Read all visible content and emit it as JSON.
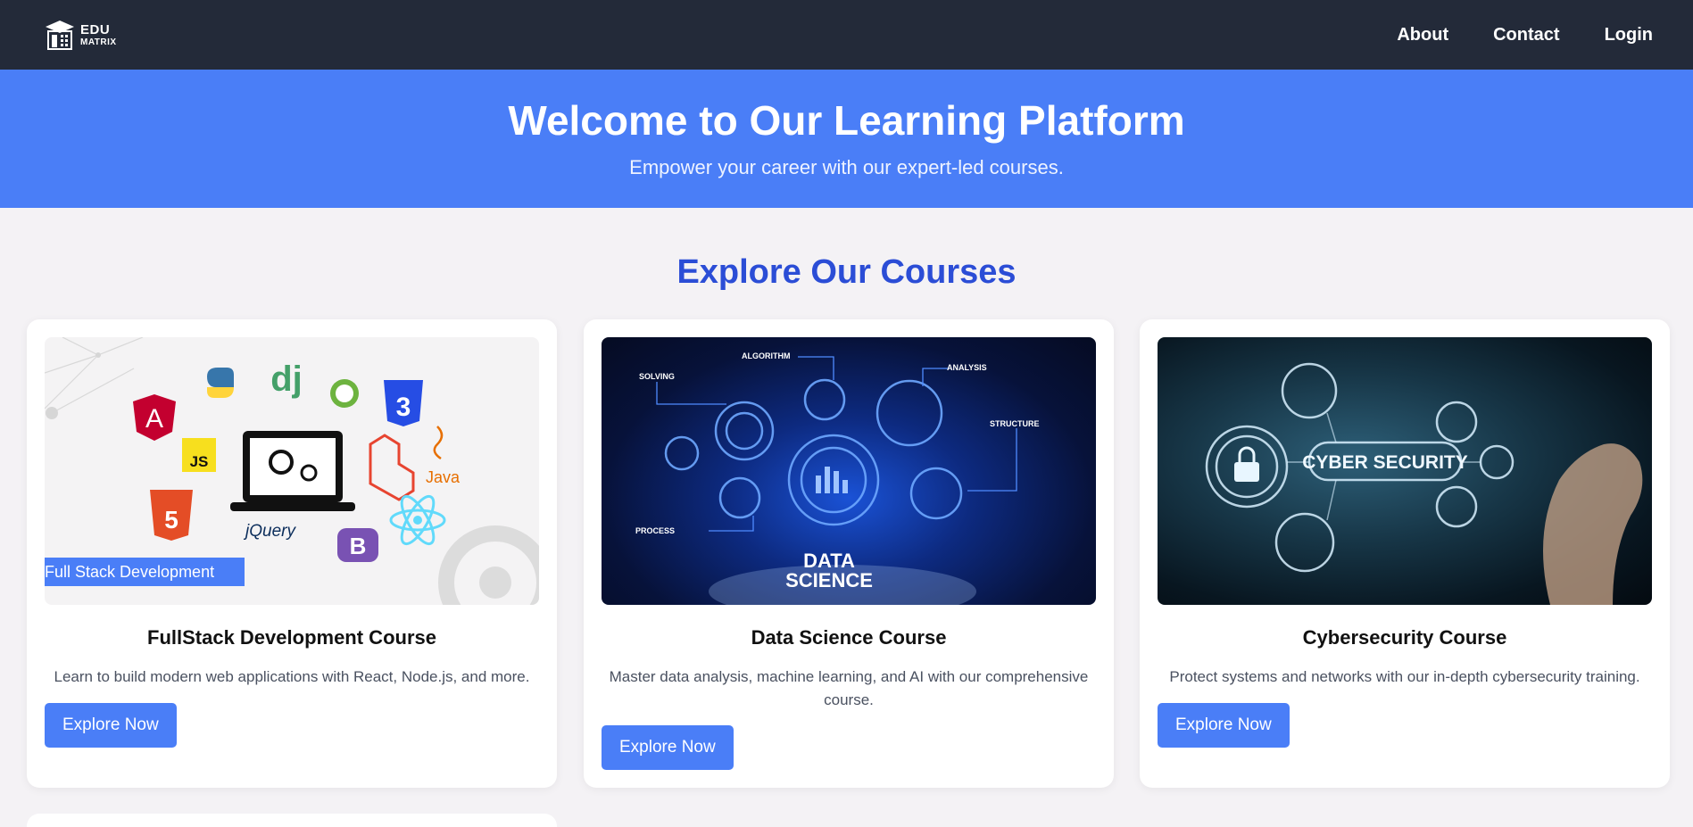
{
  "brand": {
    "line1": "EDU",
    "line2": "MATRIX"
  },
  "nav": {
    "about": "About",
    "contact": "Contact",
    "login": "Login"
  },
  "hero": {
    "title": "Welcome to Our Learning Platform",
    "subtitle": "Empower your career with our expert-led courses."
  },
  "section_title": "Explore Our Courses",
  "courses": [
    {
      "image_caption": "Full Stack Development",
      "title": "FullStack Development Course",
      "description": "Learn to build modern web applications with React, Node.js, and more.",
      "button": "Explore Now",
      "image_labels": [
        "JS",
        "dj",
        "jQuery",
        "B",
        "Java"
      ]
    },
    {
      "title": "Data Science Course",
      "description": "Master data analysis, machine learning, and AI with our comprehensive course.",
      "button": "Explore Now",
      "image_labels": [
        "SOLVING",
        "ALGORITHM",
        "ANALYSIS",
        "STRUCTURE",
        "PROCESS",
        "DATA",
        "SCIENCE"
      ]
    },
    {
      "title": "Cybersecurity Course",
      "description": "Protect systems and networks with our in-depth cybersecurity training.",
      "button": "Explore Now",
      "image_labels": [
        "CYBER SECURITY"
      ]
    }
  ],
  "colors": {
    "navbar": "#232a39",
    "hero": "#4a7ef7",
    "accent_title": "#2b4dd6",
    "button": "#4a7ef7",
    "page_bg": "#f4f2f5"
  },
  "icons": [
    "graduation-cap-building-icon"
  ]
}
